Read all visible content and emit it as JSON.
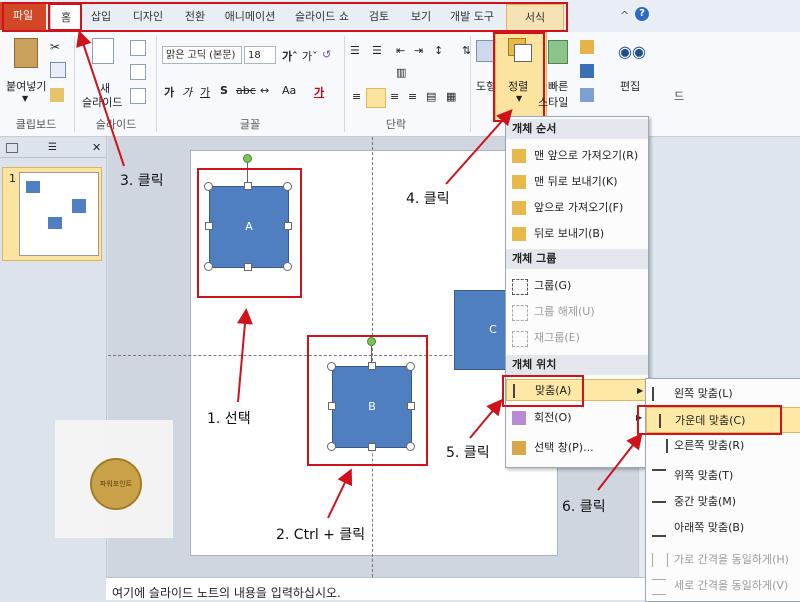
{
  "tabs": {
    "file": "파일",
    "home": "홈",
    "insert": "삽입",
    "design": "디자인",
    "transitions": "전환",
    "animations": "애니메이션",
    "slideshow": "슬라이드 쇼",
    "review": "검토",
    "view": "보기",
    "developer": "개발 도구",
    "format": "서식"
  },
  "ribbon": {
    "paste": "붙여넣기",
    "new_slide_1": "새",
    "new_slide_2": "슬라이드",
    "font_name": "맑은 고딕 (본문)",
    "font_size": "18",
    "groups": {
      "clipboard": "클립보드",
      "slides": "슬라이드",
      "font": "글꼴",
      "paragraph": "단락"
    },
    "drawing_fragment": "도형",
    "arrange": "정렬",
    "quick_styles_1": "빠른",
    "quick_styles_2": "스타일",
    "editing": "편집",
    "right_fragment": "드"
  },
  "thumbs": {
    "slide_number": "1"
  },
  "slide": {
    "shape_a": "A",
    "shape_b": "B",
    "shape_c": "C",
    "logo_text": "파워포인트"
  },
  "menu": {
    "order_header": "개체 순서",
    "bring_front": "맨 앞으로 가져오기(R)",
    "send_back": "맨 뒤로 보내기(K)",
    "bring_forward": "앞으로 가져오기(F)",
    "send_backward": "뒤로 보내기(B)",
    "group_header": "개체 그룹",
    "group": "그룹(G)",
    "ungroup": "그룹 해제(U)",
    "regroup": "재그룹(E)",
    "position_header": "개체 위치",
    "align": "맞춤(A)",
    "rotate": "회전(O)",
    "selection_pane": "선택 창(P)..."
  },
  "submenu": {
    "align_left": "왼쪽 맞춤(L)",
    "align_center": "가운데 맞춤(C)",
    "align_right": "오른쪽 맞춤(R)",
    "align_top": "위쪽 맞춤(T)",
    "align_middle": "중간 맞춤(M)",
    "align_bottom": "아래쪽 맞춤(B)",
    "distribute_h": "가로 간격을 동일하게(H)",
    "distribute_v": "세로 간격을 동일하게(V)"
  },
  "notes_placeholder": "여기에 슬라이드 노트의 내용을 입력하십시오.",
  "annotations": {
    "step1": "1. 선택",
    "step2": "2. Ctrl + 클릭",
    "step3": "3. 클릭",
    "step4": "4. 클릭",
    "step5": "5. 클릭",
    "step6": "6. 클릭"
  },
  "colors": {
    "annotation_red": "#d0121c",
    "shape_fill": "#4f7fc0",
    "file_tab": "#d24726",
    "highlight": "#fde9a5"
  }
}
